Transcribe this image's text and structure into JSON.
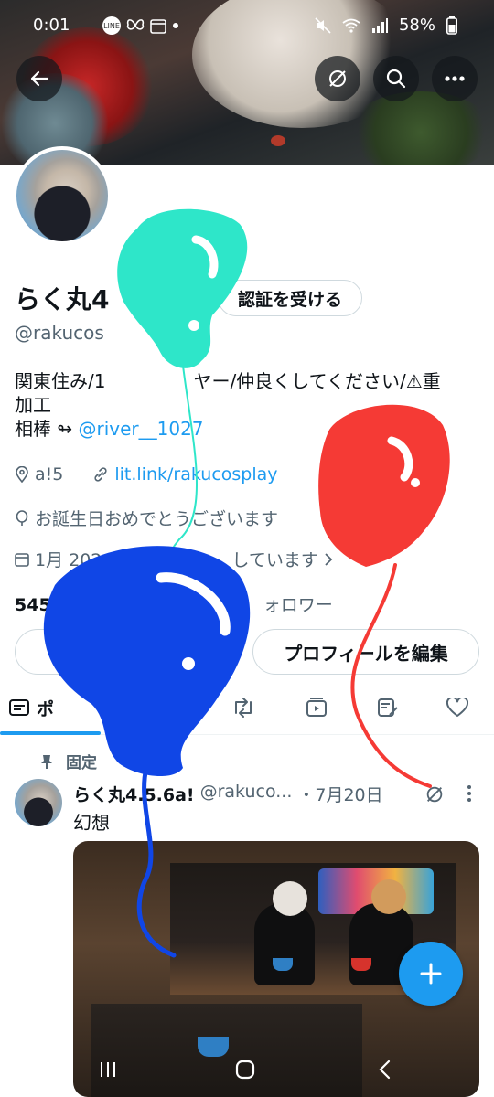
{
  "status_bar": {
    "time": "0:01",
    "battery": "58%"
  },
  "profile": {
    "name": "らく丸4",
    "verify_label": "認証を受ける",
    "handle": "@rakucos",
    "bio_line1": "関東住み/1",
    "bio_line1_b": "ヤー/仲良くしてください/⚠重",
    "bio_line2": "加工",
    "bio_partner_prefix": "相棒 ↬ ",
    "bio_partner_handle": "@river__1027",
    "location": "a!5",
    "website": "lit.link/rakucosplay",
    "birthday": "お誕生日おめでとうございます",
    "joined_prefix": "1月 202",
    "joined_suffix": "しています",
    "following_count": "545",
    "followers_label": "ォロワー",
    "edit_profile_label": "プロフィールを編集"
  },
  "tabs": {
    "posts_label": "ポ"
  },
  "post": {
    "pinned_label": "固定",
    "author_name": "らく丸4.5.6a!",
    "author_handle": "@rakuco...",
    "date": "・7月20日",
    "text": "幻想"
  },
  "colors": {
    "accent": "#1d9bf0",
    "balloon_teal": "#2ee6c9",
    "balloon_red": "#f53a35",
    "balloon_blue": "#1046e6"
  },
  "icons": {
    "back": "back-arrow-icon",
    "grok": "grok-slash-icon",
    "search": "search-icon",
    "more": "more-dots-icon"
  }
}
